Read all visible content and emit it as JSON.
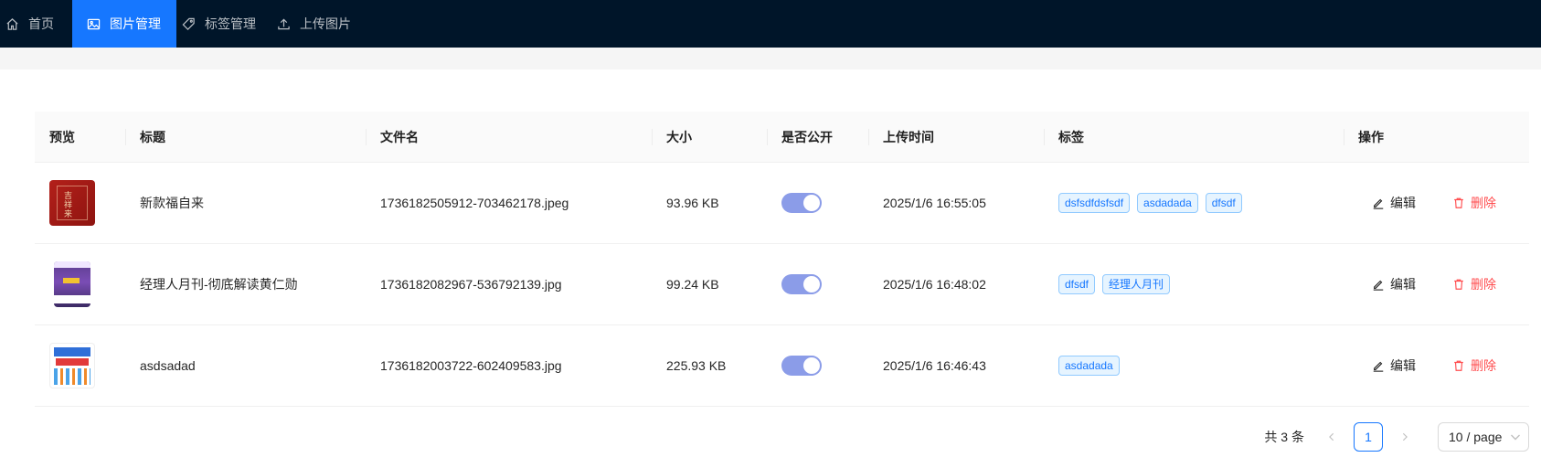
{
  "nav": {
    "items": [
      {
        "label": "首页",
        "icon": "home-icon"
      },
      {
        "label": "图片管理",
        "icon": "picture-icon"
      },
      {
        "label": "标签管理",
        "icon": "tag-icon"
      },
      {
        "label": "上传图片",
        "icon": "upload-icon"
      }
    ],
    "active_index": 1,
    "active_color": "#1677ff",
    "background": "#001529"
  },
  "table": {
    "columns": [
      "预览",
      "标题",
      "文件名",
      "大小",
      "是否公开",
      "上传时间",
      "标签",
      "操作"
    ],
    "rows": [
      {
        "title": "新款福自来",
        "filename": "1736182505912-703462178.jpeg",
        "size": "93.96 KB",
        "public": true,
        "uploaded": "2025/1/6 16:55:05",
        "tags": [
          "dsfsdfdsfsdf",
          "asdadada",
          "dfsdf"
        ]
      },
      {
        "title": "经理人月刊-彻底解读黄仁勋",
        "filename": "1736182082967-536792139.jpg",
        "size": "99.24 KB",
        "public": true,
        "uploaded": "2025/1/6 16:48:02",
        "tags": [
          "dfsdf",
          "经理人月刊"
        ]
      },
      {
        "title": "asdsadad",
        "filename": "1736182003722-602409583.jpg",
        "size": "225.93 KB",
        "public": true,
        "uploaded": "2025/1/6 16:46:43",
        "tags": [
          "asdadada"
        ]
      }
    ],
    "actions": {
      "edit": "编辑",
      "delete": "删除"
    }
  },
  "pagination": {
    "total_text": "共 3 条",
    "current_page": "1",
    "page_size": "10 / page"
  }
}
